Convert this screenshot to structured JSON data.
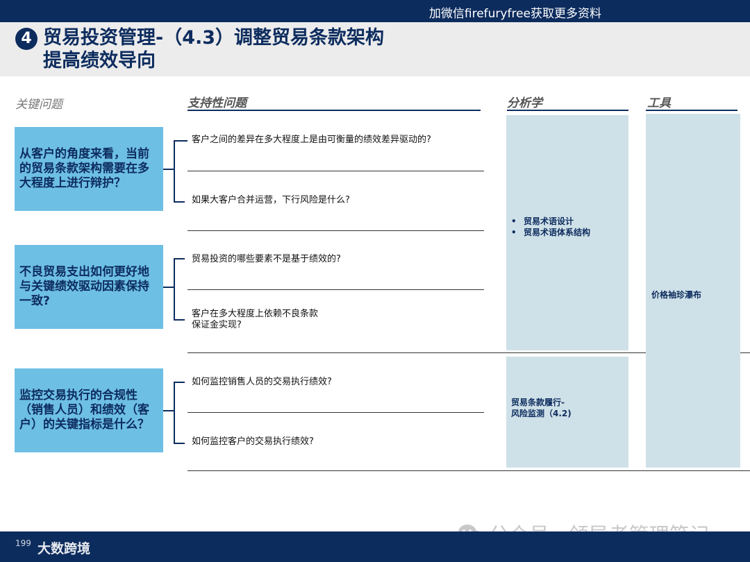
{
  "topbar": {
    "text": "加微信firefuryfree获取更多资料"
  },
  "header": {
    "number": "4",
    "title_line1": "贸易投资管理-（4.3）调整贸易条款架构",
    "title_line2": "提高绩效导向"
  },
  "columns": {
    "key_issues": "关键问题",
    "supporting": "支持性问题",
    "analytics": "分析学",
    "tools": "工具"
  },
  "groups": [
    {
      "key": "从客户的角度来看，当前的贸易条款架构需要在多大程度上进行辩护？",
      "questions": [
        "客户之间的差异在多大程度上是由可衡量的绩效差异驱动的?",
        "如果大客户合并运营，下行风险是什么?"
      ]
    },
    {
      "key": "不良贸易支出如何更好地与关键绩效驱动因素保持一致?",
      "questions": [
        "贸易投资的哪些要素不是基于绩效的?",
        "客户在多大程度上依赖不良条款\n保证金实现?"
      ]
    },
    {
      "key": "监控交易执行的合规性（销售人员）和绩效（客户）的关键指标是什么？",
      "questions": [
        "如何监控销售人员的交易执行绩效?",
        "如何监控客户的交易执行绩效?"
      ]
    }
  ],
  "analytics": {
    "bullets": [
      "贸易术语设计",
      "贸易术语体系结构"
    ],
    "panel2_line1": "贸易条款履行-",
    "panel2_line2": "风险监测（4.2)"
  },
  "tools": {
    "text": "价格袖珍瀑布"
  },
  "footer": {
    "logo": "大数跨境",
    "page_num": "199",
    "watermark": "公众号 · 领导者管理笔记"
  }
}
